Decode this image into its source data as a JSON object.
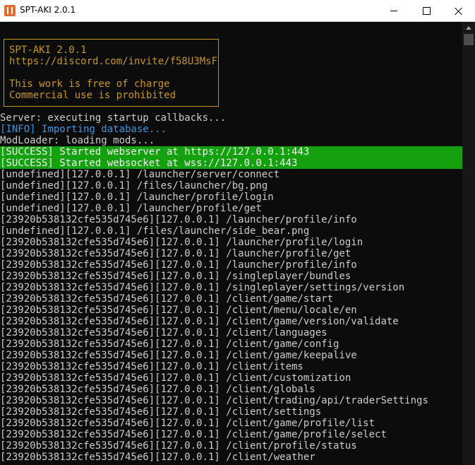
{
  "window": {
    "title": "SPT-AKI 2.0.1",
    "icon": "spt-aki-app-icon"
  },
  "banner": {
    "version": "SPT-AKI 2.0.1",
    "link": "https://discord.com/invite/f58U3MsF",
    "line1": "This work is free of charge",
    "line2": "Commercial use is prohibited"
  },
  "colors": {
    "background": "#0c0c0c",
    "text": "#cccccc",
    "info": "#3a96dd",
    "success_bg": "#13a10e",
    "banner": "#c8961e"
  },
  "log": [
    "Server: executing startup callbacks...",
    "[INFO] Importing database...",
    "ModLoader: loading mods...",
    "[SUCCESS] Started webserver at https://127.0.0.1:443",
    "[SUCCESS] Started websocket at wss://127.0.0.1:443",
    "[undefined][127.0.0.1] /launcher/server/connect",
    "[undefined][127.0.0.1] /files/launcher/bg.png",
    "[undefined][127.0.0.1] /launcher/profile/login",
    "[undefined][127.0.0.1] /launcher/profile/get",
    "[23920b538132cfe535d745e6][127.0.0.1] /launcher/profile/info",
    "[undefined][127.0.0.1] /files/launcher/side_bear.png",
    "[23920b538132cfe535d745e6][127.0.0.1] /launcher/profile/login",
    "[23920b538132cfe535d745e6][127.0.0.1] /launcher/profile/get",
    "[23920b538132cfe535d745e6][127.0.0.1] /launcher/profile/info",
    "[23920b538132cfe535d745e6][127.0.0.1] /singleplayer/bundles",
    "[23920b538132cfe535d745e6][127.0.0.1] /singleplayer/settings/version",
    "[23920b538132cfe535d745e6][127.0.0.1] /client/game/start",
    "[23920b538132cfe535d745e6][127.0.0.1] /client/menu/locale/en",
    "[23920b538132cfe535d745e6][127.0.0.1] /client/game/version/validate",
    "[23920b538132cfe535d745e6][127.0.0.1] /client/languages",
    "[23920b538132cfe535d745e6][127.0.0.1] /client/game/config",
    "[23920b538132cfe535d745e6][127.0.0.1] /client/game/keepalive",
    "[23920b538132cfe535d745e6][127.0.0.1] /client/items",
    "[23920b538132cfe535d745e6][127.0.0.1] /client/customization",
    "[23920b538132cfe535d745e6][127.0.0.1] /client/globals",
    "[23920b538132cfe535d745e6][127.0.0.1] /client/trading/api/traderSettings",
    "[23920b538132cfe535d745e6][127.0.0.1] /client/settings",
    "[23920b538132cfe535d745e6][127.0.0.1] /client/game/profile/list",
    "[23920b538132cfe535d745e6][127.0.0.1] /client/game/profile/select",
    "[23920b538132cfe535d745e6][127.0.0.1] /client/profile/status",
    "[23920b538132cfe535d745e6][127.0.0.1] /client/weather"
  ]
}
